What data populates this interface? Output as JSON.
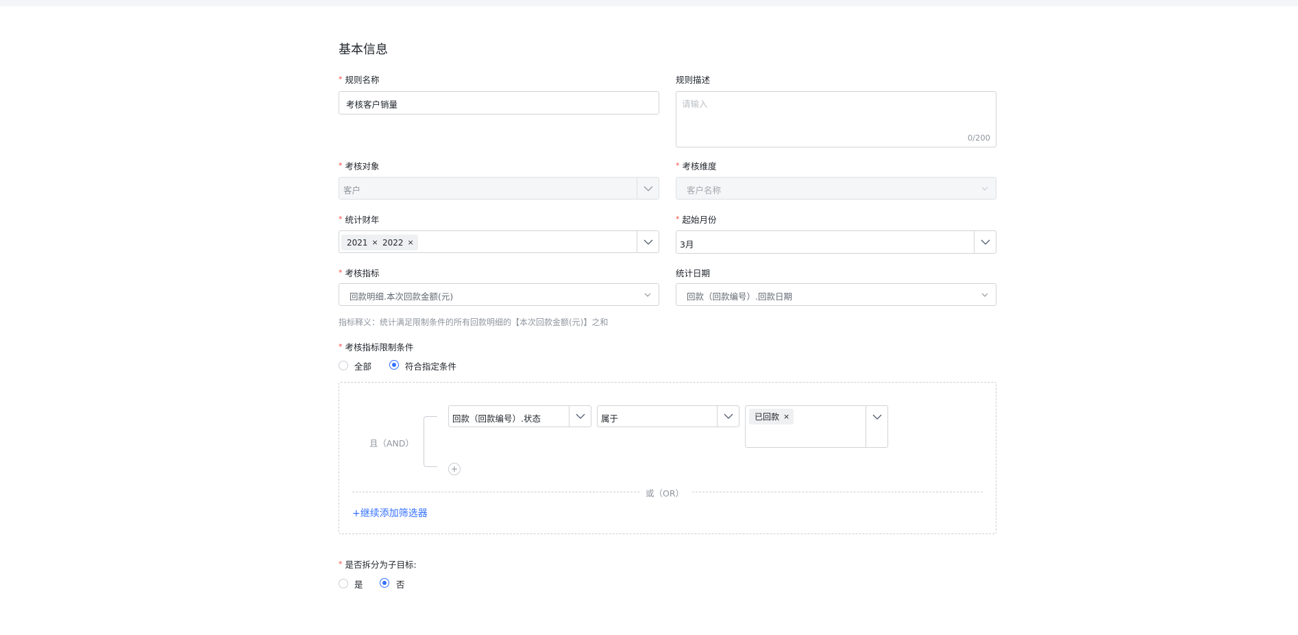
{
  "section_title": "基本信息",
  "fields": {
    "rule_name": {
      "label": "规则名称",
      "value": "考核客户销量"
    },
    "rule_desc": {
      "label": "规则描述",
      "placeholder": "请输入",
      "counter": "0/200"
    },
    "target": {
      "label": "考核对象",
      "value": "客户"
    },
    "dimension": {
      "label": "考核维度",
      "value": "客户名称"
    },
    "fiscal_year": {
      "label": "统计财年",
      "tags": [
        "2021",
        "2022"
      ]
    },
    "start_month": {
      "label": "起始月份",
      "value": "3月"
    },
    "indicator": {
      "label": "考核指标",
      "value": "回款明细.本次回款金额(元)"
    },
    "stat_date": {
      "label": "统计日期",
      "value": "回款（回款编号）.回款日期"
    }
  },
  "hint": "指标释义：统计满足限制条件的所有回款明细的【本次回款金额(元)】之和",
  "limit": {
    "label": "考核指标限制条件",
    "options": [
      "全部",
      "符合指定条件"
    ],
    "selected": "符合指定条件"
  },
  "filter": {
    "and_label": "且（AND）",
    "field": "回款（回款编号）.状态",
    "operator": "属于",
    "value_tags": [
      "已回款"
    ],
    "or_label": "或（OR）",
    "add_label": "+继续添加筛选器"
  },
  "split": {
    "label": "是否拆分为子目标:",
    "options": [
      "是",
      "否"
    ],
    "selected": "否"
  },
  "colors": {
    "accent": "#3370ff",
    "required": "#f54a45",
    "border": "#d0d3d6"
  },
  "icons": {
    "dropdown": "chevron-down-icon",
    "remove": "close-icon",
    "add": "plus-icon"
  }
}
